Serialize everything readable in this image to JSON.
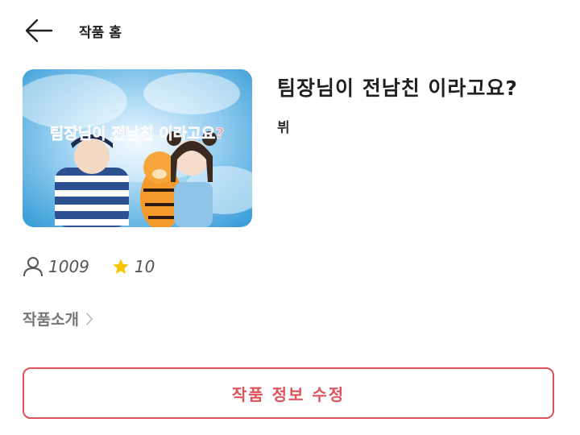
{
  "header": {
    "title": "작품 홈",
    "back_icon": "arrow-left-icon"
  },
  "work": {
    "title": "팀장님이 전남친 이라고요?",
    "author": "뷔",
    "cover": {
      "overlay_text": "팀장님이 전남친 이라고요?",
      "colors": {
        "sky": "#5fb6e6",
        "overlay_text": "#f2a3b2"
      }
    }
  },
  "stats": {
    "views_icon": "person-icon",
    "views": "1009",
    "likes_icon": "star-icon",
    "likes": "10",
    "star_color": "#f7c400"
  },
  "intro": {
    "label": "작품소개",
    "icon": "chevron-right-icon"
  },
  "edit_button": {
    "label": "작품 정보 수정",
    "color": "#e0525a"
  }
}
